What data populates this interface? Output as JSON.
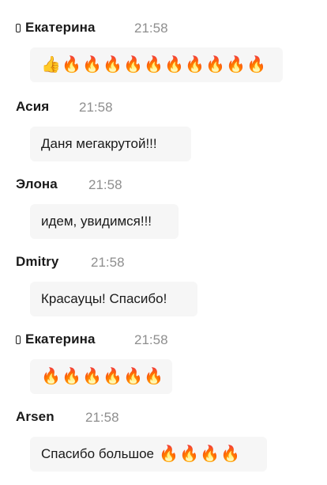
{
  "messages": [
    {
      "sender": "Екатерина",
      "has_phone_icon": true,
      "time": "21:58",
      "text": "",
      "emojis": [
        "👍",
        "🔥",
        "🔥",
        "🔥",
        "🔥",
        "🔥",
        "🔥",
        "🔥",
        "🔥",
        "🔥",
        "🔥"
      ]
    },
    {
      "sender": "Асия",
      "has_phone_icon": false,
      "time": "21:58",
      "text": "Даня мегакрутой!!!",
      "emojis": []
    },
    {
      "sender": "Элона",
      "has_phone_icon": false,
      "time": "21:58",
      "text": "идем, увидимся!!!",
      "emojis": []
    },
    {
      "sender": "Dmitry",
      "has_phone_icon": false,
      "time": "21:58",
      "text": "Красауцы! Спасибо!",
      "emojis": []
    },
    {
      "sender": "Екатерина",
      "has_phone_icon": true,
      "time": "21:58",
      "text": "",
      "emojis": [
        "🔥",
        "🔥",
        "🔥",
        "🔥",
        "🔥",
        "🔥"
      ]
    },
    {
      "sender": "Arsen",
      "has_phone_icon": false,
      "time": "21:58",
      "text": "Спасибо большое",
      "emojis": [
        "🔥",
        "🔥",
        "🔥",
        "🔥"
      ]
    }
  ],
  "colors": {
    "background": "#ffffff",
    "bubble": "#f6f6f6",
    "sender_text": "#1a1a1a",
    "time_text": "#8e8e8e"
  }
}
